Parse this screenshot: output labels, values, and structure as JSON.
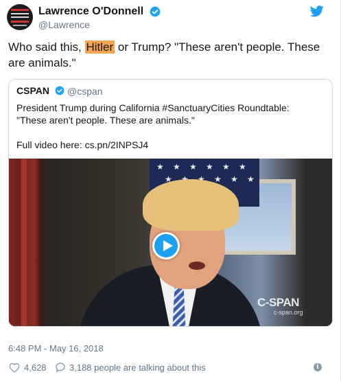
{
  "author": {
    "name": "Lawrence O'Donnell",
    "handle": "@Lawrence"
  },
  "tweet": {
    "text_before": "Who said this, ",
    "highlight": "Hitler",
    "text_after": " or Trump? \"These aren't people. These are animals.\""
  },
  "quoted": {
    "name": "CSPAN",
    "handle": "@cspan",
    "line1": "President Trump during California #SanctuaryCities Roundtable:",
    "line2": "\"These aren't people. These are animals.\"",
    "line3": "Full video here: cs.pn/2INPSJ4",
    "video": {
      "watermark": "C-SPAN",
      "watermark_url": "c-span.org"
    }
  },
  "footer": {
    "timestamp": "6:48 PM - May 16, 2018",
    "likes": "4,628",
    "talking": "3,188 people are talking about this"
  },
  "colors": {
    "accent": "#1da1f2",
    "highlight": "#f5a650",
    "secondary_text": "#657786"
  },
  "icons": [
    "verified-badge-icon",
    "twitter-bird-icon",
    "play-icon",
    "heart-icon",
    "reply-icon",
    "info-icon"
  ]
}
